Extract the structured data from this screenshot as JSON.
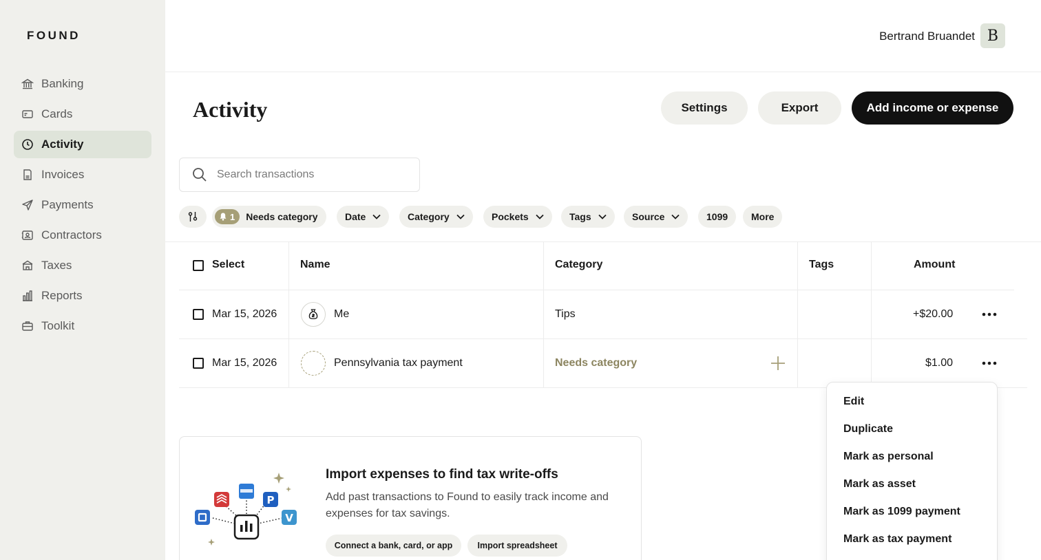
{
  "app": {
    "logo": "FOUND"
  },
  "sidebar": {
    "items": [
      {
        "label": "Banking",
        "icon": "bank-icon"
      },
      {
        "label": "Cards",
        "icon": "card-icon"
      },
      {
        "label": "Activity",
        "icon": "clock-icon",
        "active": true
      },
      {
        "label": "Invoices",
        "icon": "invoice-icon"
      },
      {
        "label": "Payments",
        "icon": "send-icon"
      },
      {
        "label": "Contractors",
        "icon": "contractor-icon"
      },
      {
        "label": "Taxes",
        "icon": "building-icon"
      },
      {
        "label": "Reports",
        "icon": "chart-icon"
      },
      {
        "label": "Toolkit",
        "icon": "briefcase-icon"
      }
    ]
  },
  "header": {
    "user_name": "Bertrand Bruandet",
    "avatar_initial": "B"
  },
  "page": {
    "title": "Activity",
    "buttons": {
      "settings": "Settings",
      "export": "Export",
      "add": "Add income or expense"
    }
  },
  "search": {
    "placeholder": "Search transactions"
  },
  "filters": {
    "needs_category_count": "1",
    "needs_category": "Needs category",
    "date": "Date",
    "category": "Category",
    "pockets": "Pockets",
    "tags": "Tags",
    "source": "Source",
    "f1099": "1099",
    "more": "More"
  },
  "table": {
    "headers": {
      "select": "Select",
      "name": "Name",
      "category": "Category",
      "tags": "Tags",
      "amount": "Amount"
    },
    "rows": [
      {
        "date": "Mar 15, 2026",
        "name": "Me",
        "category": "Tips",
        "amount": "+$20.00"
      },
      {
        "date": "Mar 15, 2026",
        "name": "Pennsylvania tax payment",
        "category": "Needs category",
        "amount": "$1.00"
      }
    ]
  },
  "import": {
    "title": "Import expenses to find tax write-offs",
    "description": "Add past transactions to Found to easily track income and expenses for tax savings.",
    "connect_button": "Connect a bank, card, or app",
    "spreadsheet_button": "Import spreadsheet"
  },
  "menu": {
    "items": [
      "Edit",
      "Duplicate",
      "Mark as personal",
      "Mark as asset",
      "Mark as 1099 payment",
      "Mark as tax payment"
    ]
  },
  "colors": {
    "sidebar_bg": "#f0f0ec",
    "active_bg": "#dfe4da",
    "accent_olive": "#a69f77",
    "primary_dark": "#111111"
  }
}
